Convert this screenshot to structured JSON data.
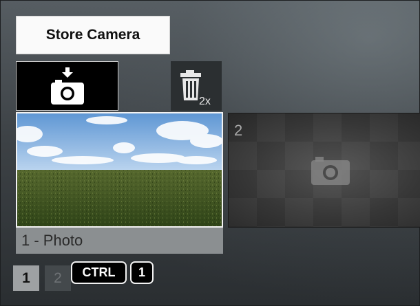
{
  "store_camera": {
    "label": "Store Camera"
  },
  "toolbar": {
    "capture_icon": "camera-store-icon",
    "delete_icon": "trash-2x-icon",
    "delete_badge": "2x"
  },
  "slots": [
    {
      "label": "1 - Photo",
      "state": "selected",
      "thumbnail": "sky-grass-photo"
    },
    {
      "number": "2",
      "state": "empty",
      "placeholder_icon": "camera-icon"
    }
  ],
  "pagination": {
    "pages": [
      "1",
      "2"
    ],
    "current": "1"
  },
  "shortcut": {
    "modifier": "CTRL",
    "key": "1"
  },
  "colors": {
    "background_top": "#565d62",
    "background_bottom": "#2a2e31",
    "selected_border": "#f2f2f2",
    "label_bg": "#8b8f91"
  }
}
